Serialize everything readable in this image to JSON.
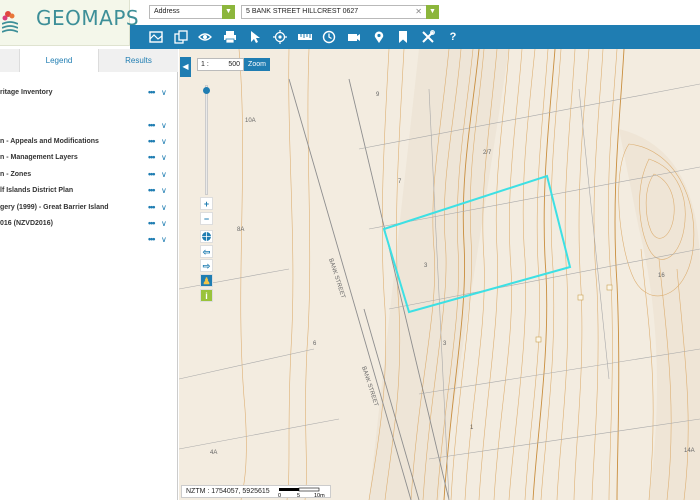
{
  "app": {
    "logo_text": "GEOMAPS"
  },
  "search": {
    "type_value": "Address",
    "address_value": "5 BANK STREET HILLCREST 0627"
  },
  "toolbar": {
    "icons": [
      "map-layers-icon",
      "copy-icon",
      "eye-icon",
      "print-icon",
      "pointer-icon",
      "locate-icon",
      "measure-icon",
      "history-icon",
      "camera-icon",
      "pin-icon",
      "bookmark-icon",
      "tools-icon",
      "help-icon"
    ],
    "help_label": "?"
  },
  "panel": {
    "tabs": [
      "Legend",
      "Results"
    ],
    "layers": [
      "ritage Inventory",
      "",
      "n - Appeals and Modifications",
      "n - Management Layers",
      "n - Zones",
      "lf Islands District Plan",
      "gery (1999) - Great Barrier Island",
      "016 (NZVD2016)",
      ""
    ],
    "more_label": "•••",
    "expand_label": "∨"
  },
  "map": {
    "scale_label": "1 :",
    "scale_value": "500",
    "zoom_label": "Zoom",
    "coords": "NZTM : 1754057, 5925615",
    "scalebar_labels": [
      "0",
      "5",
      "10m"
    ],
    "street_labels": [
      "BANK STREET",
      "BANK STREET"
    ],
    "parcel_numbers": [
      "9",
      "10A",
      "2/7",
      "7",
      "8A",
      "3",
      "6",
      "3",
      "1",
      "16",
      "4A",
      "14A"
    ],
    "highlight_color": "#3de0e4",
    "contour_color": "#d9a560"
  }
}
